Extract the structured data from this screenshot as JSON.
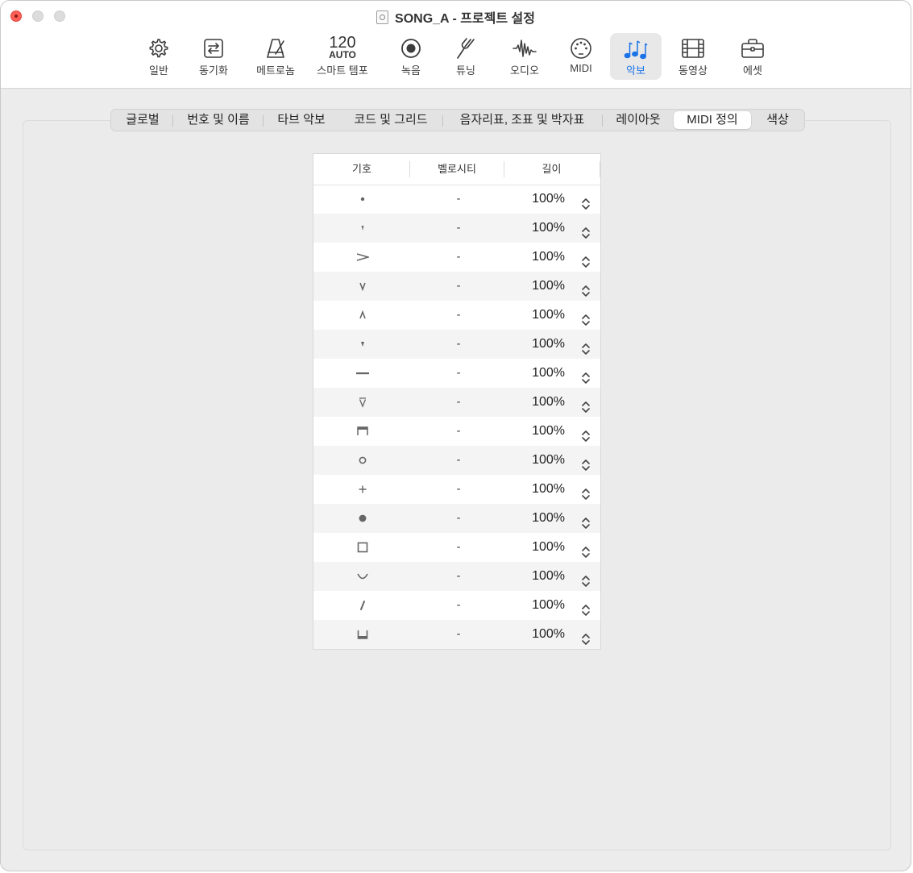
{
  "window": {
    "title": "SONG_A - 프로젝트 설정"
  },
  "toolbar": {
    "items": [
      {
        "label": "일반",
        "icon": "gear-icon"
      },
      {
        "label": "동기화",
        "icon": "sync-icon"
      },
      {
        "label": "메트로놈",
        "icon": "metronome-icon"
      },
      {
        "label": "스마트 템포",
        "icon": "smart-tempo-icon",
        "tempo_value": "120",
        "tempo_mode": "AUTO"
      },
      {
        "label": "녹음",
        "icon": "record-icon"
      },
      {
        "label": "튜닝",
        "icon": "tuning-fork-icon"
      },
      {
        "label": "오디오",
        "icon": "waveform-icon"
      },
      {
        "label": "MIDI",
        "icon": "midi-port-icon"
      },
      {
        "label": "악보",
        "icon": "score-notes-icon",
        "active": true
      },
      {
        "label": "동영상",
        "icon": "film-icon"
      },
      {
        "label": "에셋",
        "icon": "briefcase-icon"
      }
    ]
  },
  "tabs": {
    "items": [
      {
        "label": "글로벌"
      },
      {
        "label": "번호 및 이름"
      },
      {
        "label": "타브 악보"
      },
      {
        "label": "코드 및 그리드"
      },
      {
        "label": "음자리표, 조표 및 박자표"
      },
      {
        "label": "레이아웃"
      },
      {
        "label": "MIDI 정의",
        "selected": true
      },
      {
        "label": "색상"
      }
    ]
  },
  "table": {
    "headers": {
      "symbol": "기호",
      "velocity": "벨로시티",
      "length": "길이"
    },
    "rows": [
      {
        "symbol": "staccato-dot",
        "velocity": "-",
        "length": "100%"
      },
      {
        "symbol": "staccatissimo-wedge",
        "velocity": "-",
        "length": "100%"
      },
      {
        "symbol": "accent",
        "velocity": "-",
        "length": "100%"
      },
      {
        "symbol": "marcato-down",
        "velocity": "-",
        "length": "100%"
      },
      {
        "symbol": "marcato-up",
        "velocity": "-",
        "length": "100%"
      },
      {
        "symbol": "small-wedge",
        "velocity": "-",
        "length": "100%"
      },
      {
        "symbol": "tenuto",
        "velocity": "-",
        "length": "100%"
      },
      {
        "symbol": "open-wedge",
        "velocity": "-",
        "length": "100%"
      },
      {
        "symbol": "down-bow",
        "velocity": "-",
        "length": "100%"
      },
      {
        "symbol": "harmonic-circle",
        "velocity": "-",
        "length": "100%"
      },
      {
        "symbol": "plus",
        "velocity": "-",
        "length": "100%"
      },
      {
        "symbol": "large-dot",
        "velocity": "-",
        "length": "100%"
      },
      {
        "symbol": "square",
        "velocity": "-",
        "length": "100%"
      },
      {
        "symbol": "arc",
        "velocity": "-",
        "length": "100%"
      },
      {
        "symbol": "slash-stroke",
        "velocity": "-",
        "length": "100%"
      },
      {
        "symbol": "bracket-open",
        "velocity": "-",
        "length": "100%"
      }
    ]
  },
  "colors": {
    "accent": "#1a73e8",
    "close_button": "#ff5f57"
  }
}
